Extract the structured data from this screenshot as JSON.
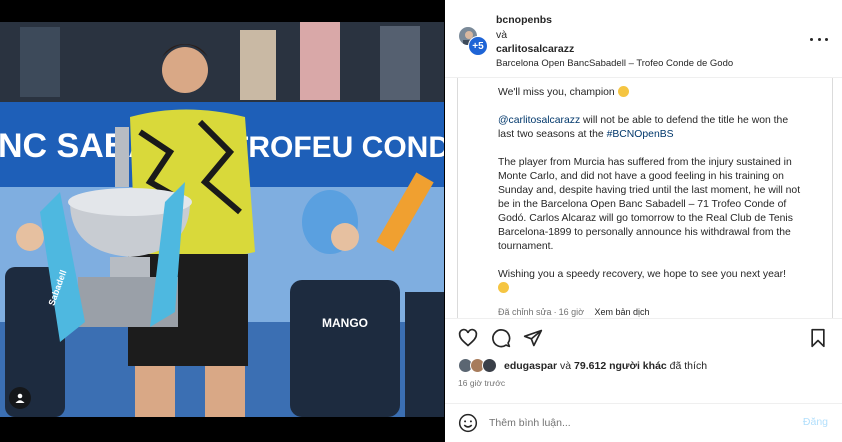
{
  "header": {
    "user1": "bcnopenbs",
    "conjunction": "và",
    "user2": "carlitosalcarazz",
    "location": "Barcelona Open BancSabadell – Trofeo Conde de Godo",
    "avatar_badge": "+5"
  },
  "photo": {
    "banner_text_left": "NC SABADE",
    "banner_text_right": "TROFEU CONDE DE",
    "shirt_brand": "MANGO",
    "trophy_ribbon": "Sabadell"
  },
  "caption": {
    "line1": "We'll miss you, champion",
    "p2_mention": "@carlitosalcarazz",
    "p2_text": " will not be able to defend the title he won the last two seasons at the ",
    "p2_hashtag": "#BCNOpenBS",
    "p3": "The player from Murcia has suffered from the injury sustained in Monte Carlo, and did not have a good feeling in his training on Sunday and, despite having tried until the last moment, he will not be in the Barcelona Open Banc Sabadell – 71 Trofeo Conde of Godó. Carlos Alcaraz will go tomorrow to the Real Club de Tenis Barcelona-1899 to personally announce his withdrawal from the tournament.",
    "p4": "Wishing you a speedy recovery, we hope to see you next year!"
  },
  "caption_meta": {
    "edited": "Đã chỉnh sửa",
    "sep": "·",
    "time": "16 giờ",
    "translate": "Xem bản dịch"
  },
  "likes": {
    "user": "edugaspar",
    "connector": " và ",
    "count": "79.612 người khác",
    "suffix": " đã thích"
  },
  "time_ago": "16 giờ trước",
  "comment": {
    "placeholder": "Thêm bình luận...",
    "post_label": "Đăng"
  },
  "colors": {
    "link": "#00376b",
    "muted": "#737373",
    "post_disabled": "#b2dffc",
    "banner_blue": "#1e5fb8"
  }
}
